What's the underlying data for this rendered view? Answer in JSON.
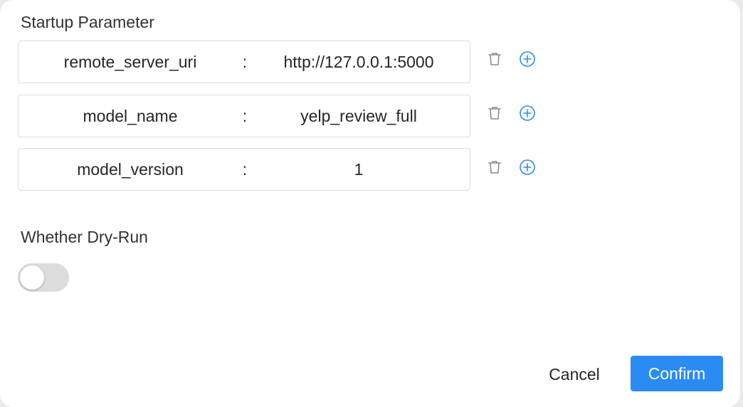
{
  "startup": {
    "title": "Startup Parameter",
    "params": [
      {
        "key": "remote_server_uri",
        "separator": ":",
        "value": "http://127.0.0.1:5000"
      },
      {
        "key": "model_name",
        "separator": ":",
        "value": "yelp_review_full"
      },
      {
        "key": "model_version",
        "separator": ":",
        "value": "1"
      }
    ],
    "delete_icon": "trash-icon",
    "add_icon": "plus-circle-icon"
  },
  "dry_run": {
    "title": "Whether Dry-Run",
    "enabled": false
  },
  "footer": {
    "cancel_label": "Cancel",
    "confirm_label": "Confirm"
  },
  "colors": {
    "accent": "#2a8cf3",
    "toggle_off": "#dcdcdc",
    "border": "#dcdcdc",
    "icon_gray": "#8c8c8c"
  }
}
